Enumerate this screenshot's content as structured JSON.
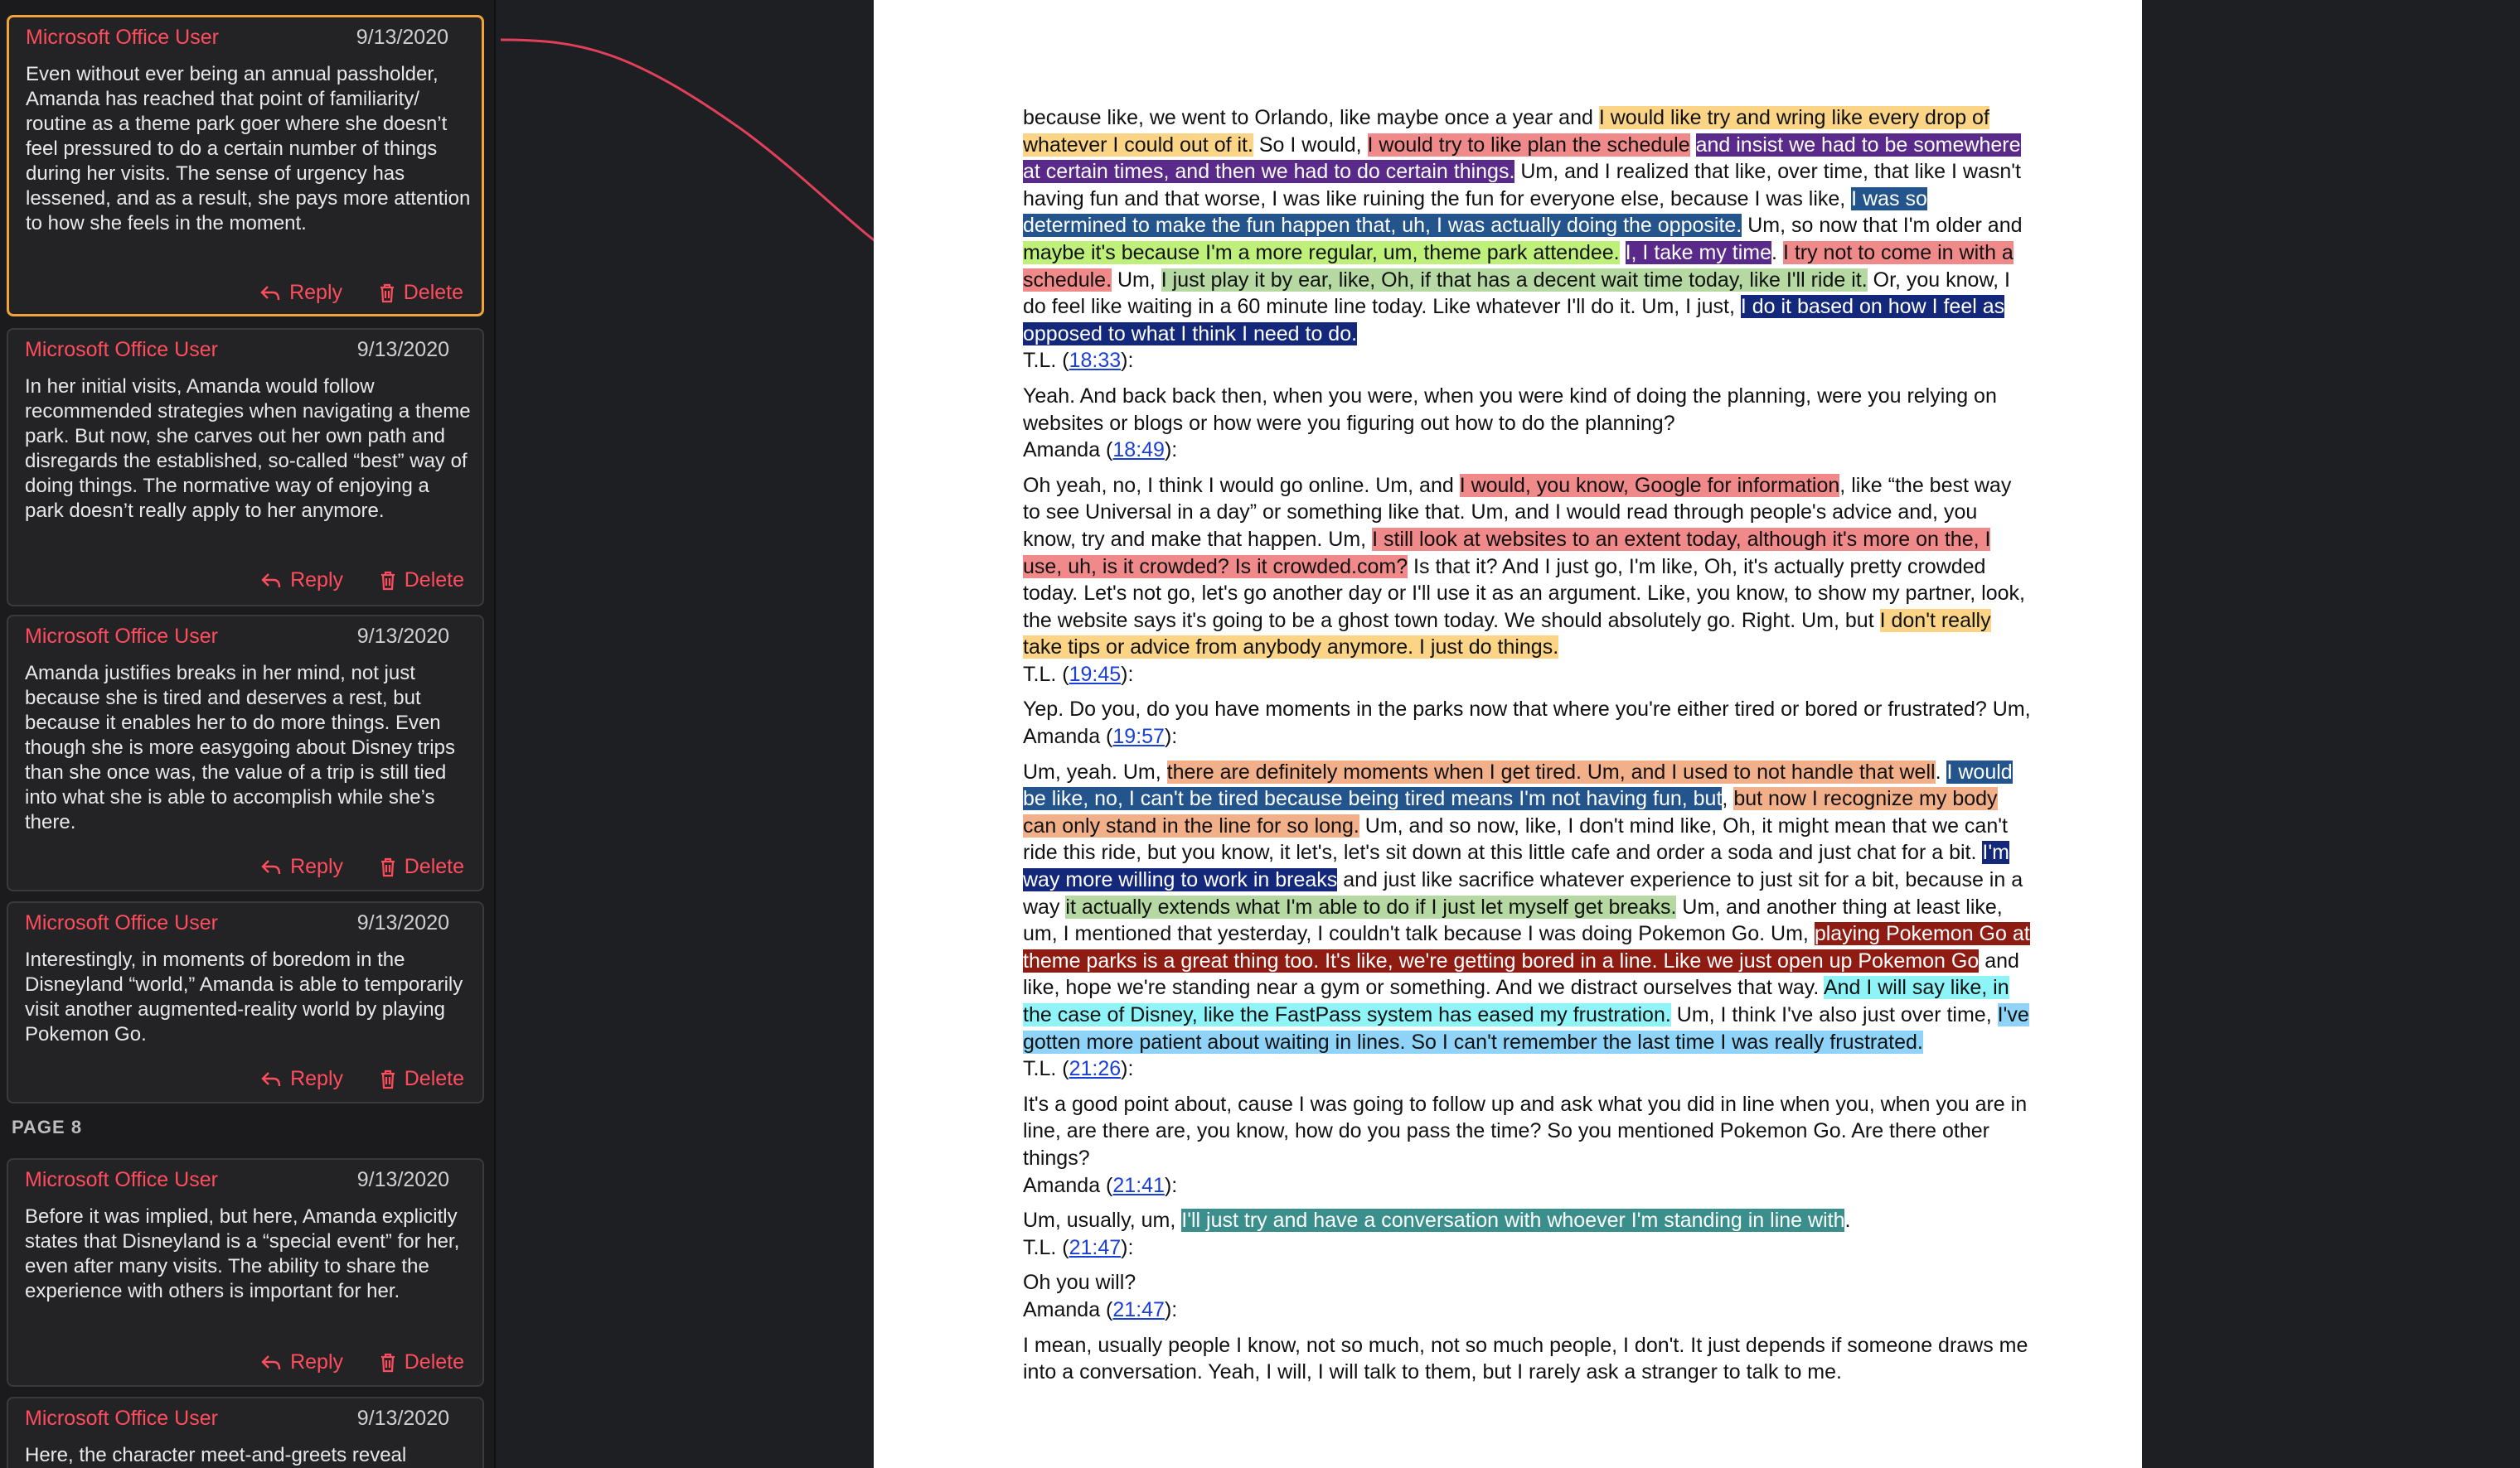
{
  "comments_top": [
    {
      "author": "Microsoft Office User",
      "date": "9/13/2020",
      "text": "Even without ever being an annual passholder, Amanda has reached that point of familiarity/ routine as a theme park goer where she doesn’t feel pressured to do a certain number of things during her visits. The sense of urgency has lessened, and as a result, she pays more attention to how she feels in the moment.",
      "reply_label": "Reply",
      "delete_label": "Delete"
    },
    {
      "author": "Microsoft Office User",
      "date": "9/13/2020",
      "text": "In her initial visits, Amanda would follow recommended strategies when navigating a theme park. But now, she carves out her own path and disregards the established, so-called “best” way of doing things. The normative way of enjoying a park doesn’t really apply to her anymore.",
      "reply_label": "Reply",
      "delete_label": "Delete"
    },
    {
      "author": "Microsoft Office User",
      "date": "9/13/2020",
      "text": "Amanda justifies breaks in her mind, not just because she is tired and deserves a rest, but because it enables her to do more things. Even though she is more easygoing about Disney trips than she once was, the value of a trip is still tied into what she is able to accomplish while she’s there.",
      "reply_label": "Reply",
      "delete_label": "Delete"
    },
    {
      "author": "Microsoft Office User",
      "date": "9/13/2020",
      "text": "Interestingly, in moments of boredom in the Disneyland “world,” Amanda is able to temporarily visit another augmented-reality world by playing Pokemon Go.",
      "reply_label": "Reply",
      "delete_label": "Delete"
    }
  ],
  "page_label": "PAGE 8",
  "comments_page8": [
    {
      "author": "Microsoft Office User",
      "date": "9/13/2020",
      "text": "Before it was implied, but here, Amanda explicitly states that Disneyland is a “special event” for her, even after many visits. The ability to share the experience with others is important for her.",
      "reply_label": "Reply",
      "delete_label": "Delete"
    },
    {
      "author": "Microsoft Office User",
      "date": "9/13/2020",
      "text": "Here, the character meet-and-greets reveal"
    }
  ],
  "doc": {
    "para1": [
      "because like, we went to Orlando, like maybe once a year and ",
      "I would like try and wring like every drop of whatever I could out of it.",
      " So I would, ",
      "I would try to like plan the schedule",
      " ",
      "and insist we had to be somewhere at certain times, and then we had to do certain things.",
      " Um, and I realized that like, over time, that like I wasn't having fun and that worse, I was like ruining the fun for everyone else, because I was like, ",
      "I was so determined to make the fun happen that, uh, I was actually doing the opposite.",
      " Um, so now that I'm older and ",
      "maybe it's because I'm a more regular, um, theme park attendee.",
      " ",
      "I, I take my time",
      ". ",
      "I try not to come in with a schedule.",
      " Um, ",
      "I just play it by ear, like, Oh, if that has a decent wait time today, like I'll ride it.",
      " Or, you know, I do feel like waiting in a 60 minute line today. Like whatever I'll do it. Um, I just, ",
      "I do it based on how I feel as opposed to what I think I need to do."
    ],
    "speaker1": "T.L. (",
    "ts1": "18:33",
    "close": "):",
    "para2": "Yeah. And back back then, when you were, when you were kind of doing the planning, were you relying on websites or blogs or how were you figuring out how to do the planning?",
    "speaker2": "Amanda (",
    "ts2": "18:49",
    "para3": [
      "Oh yeah, no, I think I would go online. Um, and ",
      "I would, you know, Google for information",
      ", like “the best way to see Universal in a day” or something like that. Um, and I would read through people's advice and, you know, try and make that happen. Um, ",
      "I still look at websites to an extent today, although it's more on the, I use, uh, is it crowded? Is it crowded.com?",
      " Is that it? And I just go, I'm like, Oh, it's actually pretty crowded today. Let's not go, let's go another day or I'll use it as an argument. Like, you know, to show my partner, look, the website says it's going to be a ghost town today. We should absolutely go. Right. Um, but ",
      "I don't really take tips or advice from anybody anymore. I just do things."
    ],
    "speaker3": "T.L. (",
    "ts3": "19:45",
    "para4": "Yep. Do you, do you have moments in the parks now that where you're either tired or bored or frustrated? Um,",
    "speaker4": "Amanda (",
    "ts4": "19:57",
    "para5": [
      "Um, yeah. Um, ",
      "there are definitely moments when I get tired. Um, and I used to not handle that well",
      ". ",
      "I would be like, no, I can't be tired because being tired means I'm not having fun, but",
      ", ",
      "but now I recognize my body can only stand in the line for so long.",
      " Um, and so now, like, I don't mind like, Oh, it might mean that we can't ride this ride, but you know, it let's, let's sit down at this little cafe and order a soda and just chat for a bit. ",
      "I'm way more willing to work in breaks",
      " and just like sacrifice whatever experience to just sit for a bit, because in a way ",
      "it actually extends what I'm able to do if I just let myself get breaks.",
      " Um, and another thing at least like, um, I mentioned that yesterday, I couldn't talk because I was doing Pokemon Go. Um, ",
      "playing Pokemon Go at theme parks is a great thing too. It's like, we're getting bored in a line. Like we just open up Pokemon Go",
      " and like, hope we're standing near a gym or something. And we distract ourselves that way. ",
      "And I will say like, in the case of Disney, like the FastPass system has eased my frustration.",
      " Um, I think I've also just over time, ",
      "I've gotten more patient about waiting in lines. So I can't remember the last time I was really frustrated."
    ],
    "speaker5": "T.L. (",
    "ts5": "21:26",
    "para6": "It's a good point about, cause I was going to follow up and ask what you did in line when you, when you are in line, are there are, you know, how do you pass the time? So you mentioned Pokemon Go. Are there other things?",
    "speaker6": "Amanda (",
    "ts6": "21:41",
    "para7": [
      "Um, usually, um, ",
      "I'll just try and have a conversation with whoever I'm standing in line with",
      "."
    ],
    "speaker7": "T.L. (",
    "ts7": "21:47",
    "para8": "Oh you will?",
    "speaker8": "Amanda (",
    "ts8": "21:47",
    "para9": "I mean, usually people I know, not so much, not so much people, I don't. It just depends if someone draws me into a conversation. Yeah, I will, I will talk to them, but I rarely ask a stranger to talk to me."
  },
  "colors": {
    "accent": "#ff4d5e",
    "active_border": "#f0a43a",
    "connector": "#e0405a"
  }
}
